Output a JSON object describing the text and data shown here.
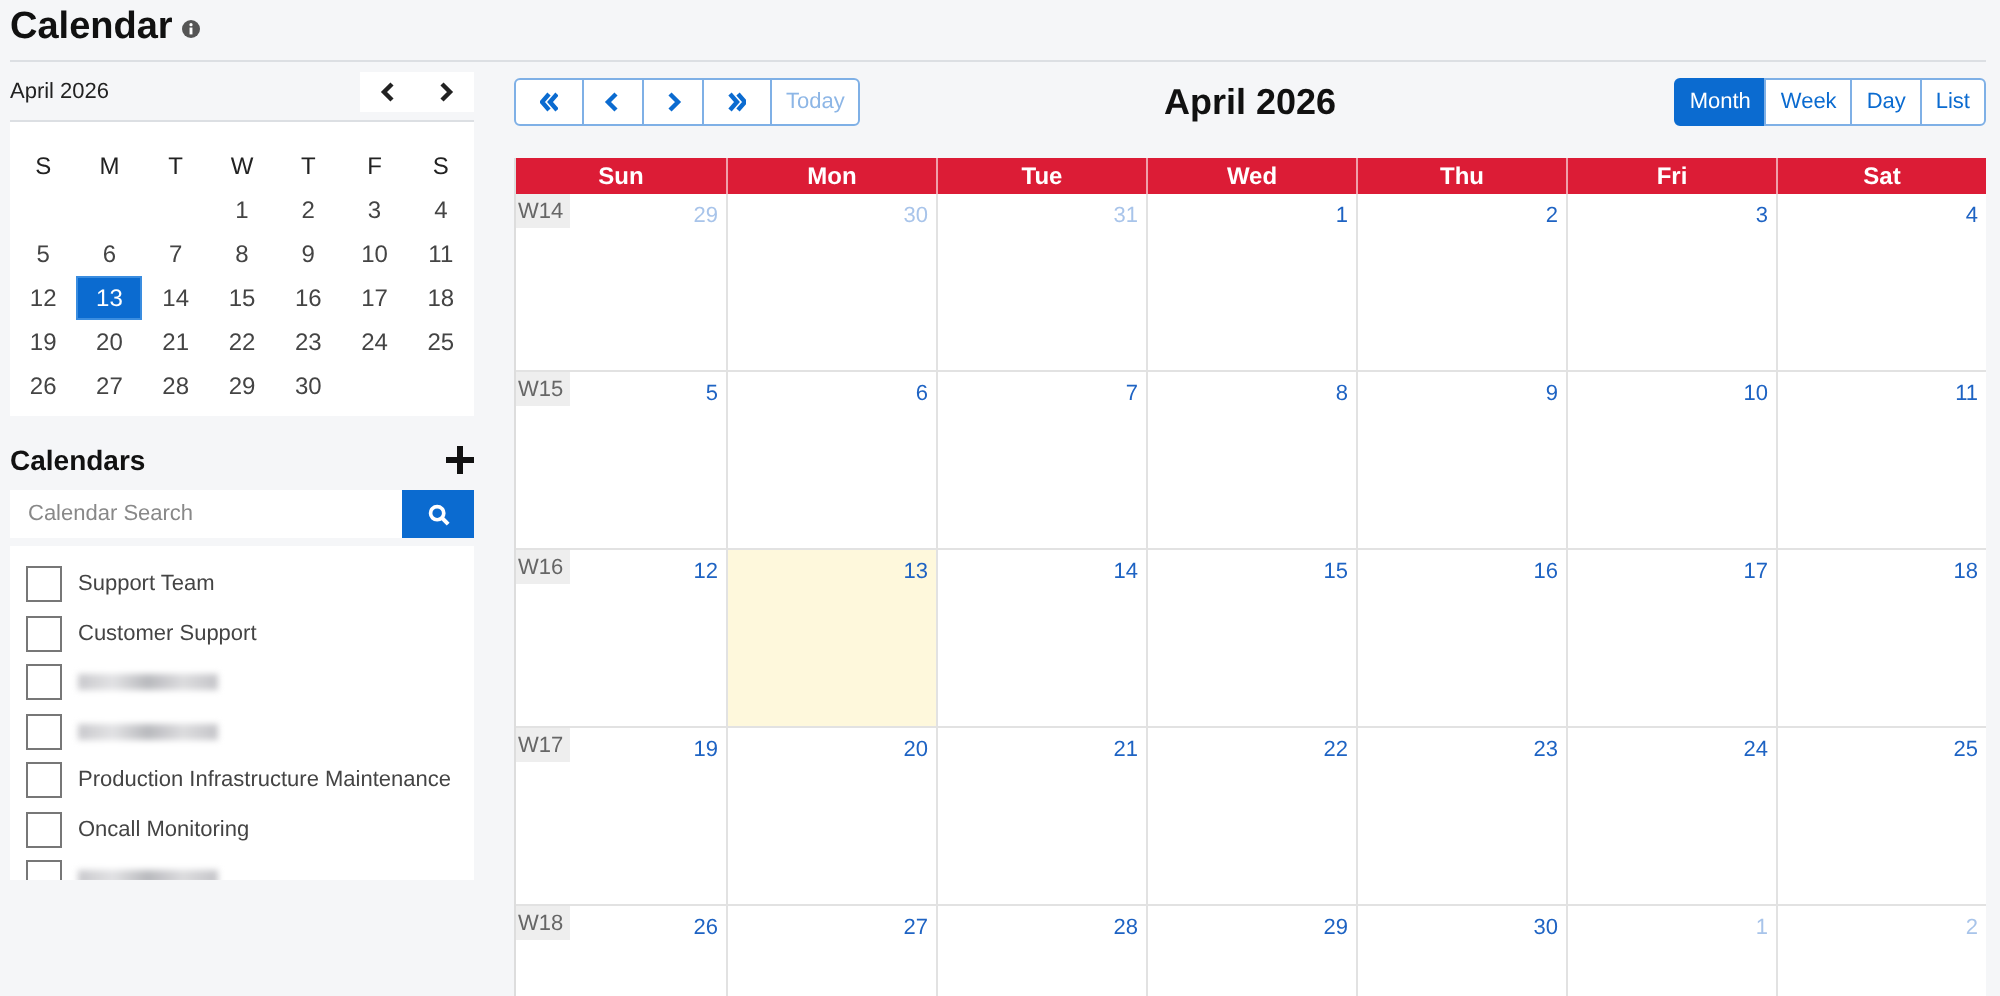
{
  "page": {
    "title": "Calendar"
  },
  "mini_calendar": {
    "month": "April 2026",
    "weekdays": [
      "S",
      "M",
      "T",
      "W",
      "T",
      "F",
      "S"
    ],
    "weeks": [
      [
        {
          "day": "1",
          "selected": false
        },
        {
          "day": "2",
          "selected": false
        },
        {
          "day": "3",
          "selected": false
        },
        {
          "day": "4",
          "selected": false
        }
      ],
      [
        {
          "day": "5",
          "selected": false
        },
        {
          "day": "6",
          "selected": false
        },
        {
          "day": "7",
          "selected": false
        },
        {
          "day": "8",
          "selected": false
        },
        {
          "day": "9",
          "selected": false
        },
        {
          "day": "10",
          "selected": false
        },
        {
          "day": "11",
          "selected": false
        }
      ],
      [
        {
          "day": "12",
          "selected": false
        },
        {
          "day": "13",
          "selected": true
        },
        {
          "day": "14",
          "selected": false
        },
        {
          "day": "15",
          "selected": false
        },
        {
          "day": "16",
          "selected": false
        },
        {
          "day": "17",
          "selected": false
        },
        {
          "day": "18",
          "selected": false
        }
      ],
      [
        {
          "day": "19",
          "selected": false
        },
        {
          "day": "20",
          "selected": false
        },
        {
          "day": "21",
          "selected": false
        },
        {
          "day": "22",
          "selected": false
        },
        {
          "day": "23",
          "selected": false
        },
        {
          "day": "24",
          "selected": false
        },
        {
          "day": "25",
          "selected": false
        }
      ],
      [
        {
          "day": "26",
          "selected": false
        },
        {
          "day": "27",
          "selected": false
        },
        {
          "day": "28",
          "selected": false
        },
        {
          "day": "29",
          "selected": false
        },
        {
          "day": "30",
          "selected": false
        }
      ]
    ]
  },
  "calendars": {
    "heading": "Calendars",
    "search": {
      "placeholder": "Calendar Search"
    },
    "items": [
      {
        "kind": "named",
        "label": "Support Team",
        "checked": false
      },
      {
        "kind": "named",
        "label": "Customer Support",
        "checked": false
      },
      {
        "kind": "redacted",
        "checked": false
      },
      {
        "kind": "redacted",
        "checked": false
      },
      {
        "kind": "named",
        "label": "Production Infrastructure Maintenance",
        "checked": false
      },
      {
        "kind": "named",
        "label": "Oncall Monitoring",
        "checked": false
      },
      {
        "kind": "redacted",
        "checked": false
      }
    ]
  },
  "toolbar": {
    "today": "Today",
    "title": "April 2026",
    "views": [
      {
        "label": "Month",
        "selected": true
      },
      {
        "label": "Week",
        "selected": false
      },
      {
        "label": "Day",
        "selected": false
      },
      {
        "label": "List",
        "selected": false
      }
    ]
  },
  "month_view": {
    "columns": [
      "Sun",
      "Mon",
      "Tue",
      "Wed",
      "Thu",
      "Fri",
      "Sat"
    ],
    "weeks": [
      {
        "label": "W14",
        "days": [
          {
            "day": "29",
            "other_month": true,
            "today": false
          },
          {
            "day": "30",
            "other_month": true,
            "today": false
          },
          {
            "day": "31",
            "other_month": true,
            "today": false
          },
          {
            "day": "1",
            "other_month": false,
            "today": false
          },
          {
            "day": "2",
            "other_month": false,
            "today": false
          },
          {
            "day": "3",
            "other_month": false,
            "today": false
          },
          {
            "day": "4",
            "other_month": false,
            "today": false
          }
        ]
      },
      {
        "label": "W15",
        "days": [
          {
            "day": "5",
            "other_month": false,
            "today": false
          },
          {
            "day": "6",
            "other_month": false,
            "today": false
          },
          {
            "day": "7",
            "other_month": false,
            "today": false
          },
          {
            "day": "8",
            "other_month": false,
            "today": false
          },
          {
            "day": "9",
            "other_month": false,
            "today": false
          },
          {
            "day": "10",
            "other_month": false,
            "today": false
          },
          {
            "day": "11",
            "other_month": false,
            "today": false
          }
        ]
      },
      {
        "label": "W16",
        "days": [
          {
            "day": "12",
            "other_month": false,
            "today": false
          },
          {
            "day": "13",
            "other_month": false,
            "today": true
          },
          {
            "day": "14",
            "other_month": false,
            "today": false
          },
          {
            "day": "15",
            "other_month": false,
            "today": false
          },
          {
            "day": "16",
            "other_month": false,
            "today": false
          },
          {
            "day": "17",
            "other_month": false,
            "today": false
          },
          {
            "day": "18",
            "other_month": false,
            "today": false
          }
        ]
      },
      {
        "label": "W17",
        "days": [
          {
            "day": "19",
            "other_month": false,
            "today": false
          },
          {
            "day": "20",
            "other_month": false,
            "today": false
          },
          {
            "day": "21",
            "other_month": false,
            "today": false
          },
          {
            "day": "22",
            "other_month": false,
            "today": false
          },
          {
            "day": "23",
            "other_month": false,
            "today": false
          },
          {
            "day": "24",
            "other_month": false,
            "today": false
          },
          {
            "day": "25",
            "other_month": false,
            "today": false
          }
        ]
      },
      {
        "label": "W18",
        "days": [
          {
            "day": "26",
            "other_month": false,
            "today": false
          },
          {
            "day": "27",
            "other_month": false,
            "today": false
          },
          {
            "day": "28",
            "other_month": false,
            "today": false
          },
          {
            "day": "29",
            "other_month": false,
            "today": false
          },
          {
            "day": "30",
            "other_month": false,
            "today": false
          },
          {
            "day": "1",
            "other_month": true,
            "today": false
          },
          {
            "day": "2",
            "other_month": true,
            "today": false
          }
        ]
      }
    ]
  }
}
